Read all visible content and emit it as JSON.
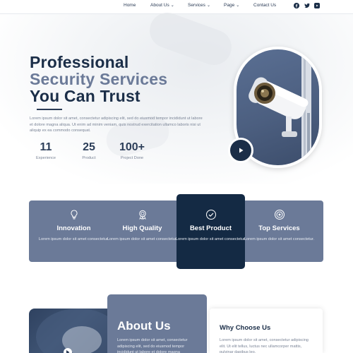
{
  "nav": {
    "items": [
      {
        "label": "Home",
        "has_dropdown": false
      },
      {
        "label": "About Us",
        "has_dropdown": true
      },
      {
        "label": "Services",
        "has_dropdown": true
      },
      {
        "label": "Page",
        "has_dropdown": true
      },
      {
        "label": "Contact Us",
        "has_dropdown": false
      }
    ],
    "social": [
      "facebook-icon",
      "twitter-icon",
      "youtube-icon"
    ]
  },
  "hero": {
    "title_line1": "Professional",
    "title_line2": "Security Services",
    "title_line3": "You Can Trust",
    "text": "Lorem ipsum dolor sit amet, consectetur adipiscing elit, sed do eiusmod tempor incididunt ut labore et dolore magna aliqua. Ut enim ad minim veniam, quis nostrud exercitation ullamco laboris nisi ut aliquip ex ea commodo consequat.",
    "stats": [
      {
        "value": "11",
        "label": "Experience"
      },
      {
        "value": "25",
        "label": "Product"
      },
      {
        "value": "100+",
        "label": "Project Done"
      }
    ]
  },
  "features": [
    {
      "icon": "lightbulb-icon",
      "title": "Innovation",
      "desc": "Lorem ipsum dolor sit amet consectetur.",
      "active": false
    },
    {
      "icon": "award-badge-icon",
      "title": "High Quality",
      "desc": "Lorem ipsum dolor sit amet consectetur.",
      "active": false
    },
    {
      "icon": "shield-check-icon",
      "title": "Best Product",
      "desc": "Lorem ipsum dolor sit amet consectetur.",
      "active": true
    },
    {
      "icon": "target-icon",
      "title": "Top Services",
      "desc": "Lorem ipsum dolor sit amet consectetur.",
      "active": false
    }
  ],
  "about": {
    "title": "About Us",
    "text": "Lorem ipsum dolor sit amet, consectetur adipiscing elit, sed do eiusmod tempor incididunt ut labore et dolore magna"
  },
  "why": {
    "title": "Why Choose Us",
    "text": "Lorem ipsum dolor sit amet, consectetur adipiscing elit. Ut elit tellus, luctus nec ullamcorper mattis, pulvinar dapibus leo."
  },
  "colors": {
    "navy": "#1b2e48",
    "slate": "#6b7a98",
    "active_card": "#142a44",
    "body_text": "#7a8496"
  }
}
